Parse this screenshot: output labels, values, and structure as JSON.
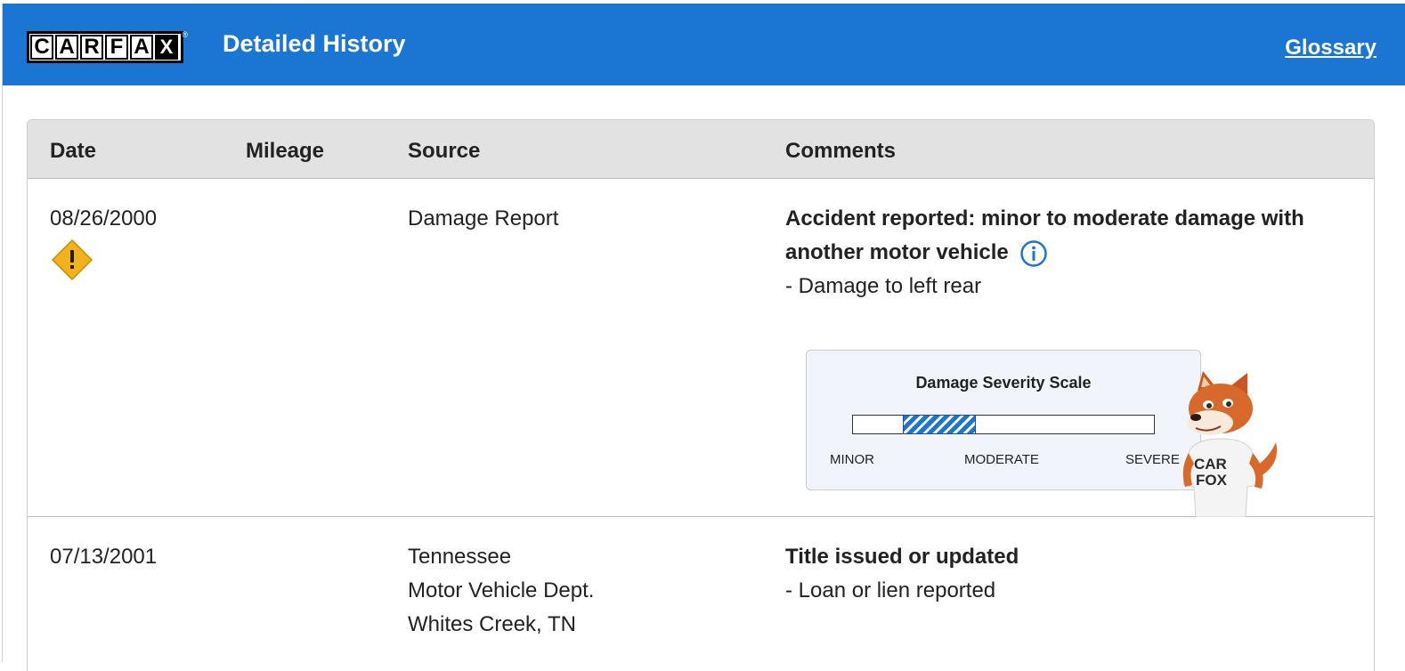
{
  "header": {
    "logo_letters": [
      "C",
      "A",
      "R",
      "F",
      "A",
      "X"
    ],
    "logo_reg": "®",
    "title": "Detailed History",
    "glossary_link": "Glossary",
    "background_color": "#1b76d3"
  },
  "table": {
    "columns": [
      "Date",
      "Mileage",
      "Source",
      "Comments"
    ],
    "rows": [
      {
        "date": "08/26/2000",
        "mileage": "",
        "date_icon": "warning-diamond-icon",
        "source_lines": [
          "Damage Report"
        ],
        "comment_title": "Accident reported: minor to moderate damage with another motor vehicle",
        "comment_details": [
          "- Damage to left rear"
        ],
        "comment_icon": "info-icon",
        "damage_scale": {
          "title": "Damage Severity Scale",
          "labels": [
            "MINOR",
            "MODERATE",
            "SEVERE"
          ],
          "level_start": 0.17,
          "level_end": 0.41
        }
      },
      {
        "date": "07/13/2001",
        "mileage": "",
        "source_lines": [
          "Tennessee",
          "Motor Vehicle Dept.",
          "Whites Creek, TN"
        ],
        "comment_title": "Title issued or updated",
        "comment_details": [
          "- Loan or lien reported"
        ]
      }
    ]
  },
  "mascot": {
    "shirt_text": [
      "CAR",
      "FOX"
    ]
  },
  "colors": {
    "accent": "#1b76d3",
    "warning": "#f2b21c",
    "header_row": "#e2e2e2",
    "scale_bg": "#f1f5fb"
  }
}
